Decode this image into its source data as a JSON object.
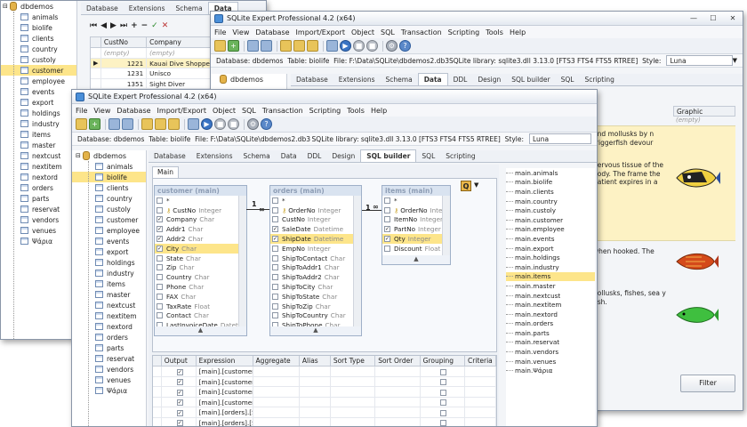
{
  "app_title": "SQLite Expert Professional 4.2 (x64)",
  "menu": [
    "File",
    "View",
    "Database",
    "Import/Export",
    "Object",
    "SQL",
    "Transaction",
    "Scripting",
    "Tools",
    "Help"
  ],
  "window_buttons": {
    "minimize": "—",
    "maximize": "☐",
    "close": "✕"
  },
  "info": {
    "database": "Database: dbdemos",
    "table": "Table: biolife",
    "file_mid": "File: F:\\Data\\SQLite\\dbdemos2.db3",
    "file_front": "File: F:\\Data\\SQLite\\dbdemos2.db3",
    "library": "SQLite library: sqlite3.dll 3.13.0 [FTS3 FTS4 FTS5 RTREE]",
    "style_label": "Style:",
    "style_value": "Luna"
  },
  "tabs_back": [
    "Database",
    "Extensions",
    "Schema",
    "Data",
    "DDL",
    "Design",
    "SQL builder",
    "SQL",
    "Scripting"
  ],
  "tabs_mid": [
    "Database",
    "Extensions",
    "Schema",
    "Data",
    "DDL",
    "Design",
    "SQL builder",
    "SQL",
    "Scripting"
  ],
  "tabs_front": [
    "Database",
    "Extensions",
    "Schema",
    "Data",
    "DDL",
    "Design",
    "SQL builder",
    "SQL",
    "Scripting"
  ],
  "tree": {
    "root": "dbdemos",
    "items": [
      "animals",
      "biolife",
      "clients",
      "country",
      "custoly",
      "customer",
      "employee",
      "events",
      "export",
      "holdings",
      "industry",
      "items",
      "master",
      "nextcust",
      "nextitem",
      "nextord",
      "orders",
      "parts",
      "reservat",
      "vendors",
      "venues",
      "Ψάρια"
    ]
  },
  "back_tree_labels": [
    "animals",
    "biolife",
    "clients",
    "country",
    "custoly",
    "customer",
    "employee",
    "events",
    "export",
    "holdings",
    "industry",
    "items",
    "master",
    "nextcust",
    "nextitem",
    "nextord",
    "orders",
    "parts",
    "reservat",
    "vendors",
    "venues",
    "Ψάρια"
  ],
  "back_grid": {
    "headers": [
      "CustNo",
      "Company"
    ],
    "rows": [
      [
        "(empty)",
        "(empty)"
      ],
      [
        "1221",
        "Kauai Dive Shoppe"
      ],
      [
        "1231",
        "Unisco"
      ],
      [
        "1351",
        "Sight Diver"
      ]
    ]
  },
  "mid_grid": {
    "graphic_header": "Graphic",
    "empty": "(empty)",
    "texts": [
      "and mollusks by n triggerfish devour",
      "nervous tissue of the body.  The frame the patient expires in a",
      "when hooked.  The",
      "nollusks, fishes, sea y fish."
    ],
    "filter_button": "Filter"
  },
  "builder": {
    "main_tab": "Main",
    "entities": [
      {
        "title": "customer (main)",
        "fields": [
          {
            "name": "*",
            "type": "",
            "checked": false,
            "key": false
          },
          {
            "name": "CustNo",
            "type": "Integer",
            "checked": false,
            "key": true
          },
          {
            "name": "Company",
            "type": "Char",
            "checked": true,
            "key": false
          },
          {
            "name": "Addr1",
            "type": "Char",
            "checked": true,
            "key": false
          },
          {
            "name": "Addr2",
            "type": "Char",
            "checked": true,
            "key": false
          },
          {
            "name": "City",
            "type": "Char",
            "checked": true,
            "key": false
          },
          {
            "name": "State",
            "type": "Char",
            "checked": false,
            "key": false
          },
          {
            "name": "Zip",
            "type": "Char",
            "checked": false,
            "key": false
          },
          {
            "name": "Country",
            "type": "Char",
            "checked": false,
            "key": false
          },
          {
            "name": "Phone",
            "type": "Char",
            "checked": false,
            "key": false
          },
          {
            "name": "FAX",
            "type": "Char",
            "checked": false,
            "key": false
          },
          {
            "name": "TaxRate",
            "type": "Float",
            "checked": false,
            "key": false
          },
          {
            "name": "Contact",
            "type": "Char",
            "checked": false,
            "key": false
          },
          {
            "name": "LastInvoiceDate",
            "type": "Datetim",
            "checked": false,
            "key": false
          }
        ]
      },
      {
        "title": "orders (main)",
        "fields": [
          {
            "name": "*",
            "type": "",
            "checked": false,
            "key": false
          },
          {
            "name": "OrderNo",
            "type": "Integer",
            "checked": false,
            "key": true
          },
          {
            "name": "CustNo",
            "type": "Integer",
            "checked": false,
            "key": false
          },
          {
            "name": "SaleDate",
            "type": "Datetime",
            "checked": true,
            "key": false
          },
          {
            "name": "ShipDate",
            "type": "Datetime",
            "checked": true,
            "key": false
          },
          {
            "name": "EmpNo",
            "type": "Integer",
            "checked": false,
            "key": false
          },
          {
            "name": "ShipToContact",
            "type": "Char",
            "checked": false,
            "key": false
          },
          {
            "name": "ShipToAddr1",
            "type": "Char",
            "checked": false,
            "key": false
          },
          {
            "name": "ShipToAddr2",
            "type": "Char",
            "checked": false,
            "key": false
          },
          {
            "name": "ShipToCity",
            "type": "Char",
            "checked": false,
            "key": false
          },
          {
            "name": "ShipToState",
            "type": "Char",
            "checked": false,
            "key": false
          },
          {
            "name": "ShipToZip",
            "type": "Char",
            "checked": false,
            "key": false
          },
          {
            "name": "ShipToCountry",
            "type": "Char",
            "checked": false,
            "key": false
          },
          {
            "name": "ShipToPhone",
            "type": "Char",
            "checked": false,
            "key": false
          }
        ]
      },
      {
        "title": "items (main)",
        "fields": [
          {
            "name": "*",
            "type": "",
            "checked": false,
            "key": false
          },
          {
            "name": "OrderNo",
            "type": "Integer",
            "checked": false,
            "key": true
          },
          {
            "name": "ItemNo",
            "type": "Integer",
            "checked": false,
            "key": false
          },
          {
            "name": "PartNo",
            "type": "Integer",
            "checked": true,
            "key": false
          },
          {
            "name": "Qty",
            "type": "Integer",
            "checked": true,
            "key": false
          },
          {
            "name": "Discount",
            "type": "Float",
            "checked": false,
            "key": false
          }
        ]
      }
    ],
    "relation_one": "1",
    "relation_many": "∞",
    "grid_headers": [
      "Output",
      "Expression",
      "Aggregate",
      "Alias",
      "Sort Type",
      "Sort Order",
      "Grouping",
      "Criteria"
    ],
    "grid_rows": [
      "[main].[customer].[C",
      "[main].[customer].[A",
      "[main].[customer].[A",
      "[main].[customer].[C",
      "[main].[orders].[Sale",
      "[main].[orders].[Ship"
    ],
    "table_list": [
      "main.animals",
      "main.biolife",
      "main.clients",
      "main.country",
      "main.custoly",
      "main.customer",
      "main.employee",
      "main.events",
      "main.export",
      "main.holdings",
      "main.industry",
      "main.items",
      "main.master",
      "main.nextcust",
      "main.nextitem",
      "main.nextord",
      "main.orders",
      "main.parts",
      "main.reservat",
      "main.vendors",
      "main.venues",
      "main.Ψάρια"
    ]
  }
}
